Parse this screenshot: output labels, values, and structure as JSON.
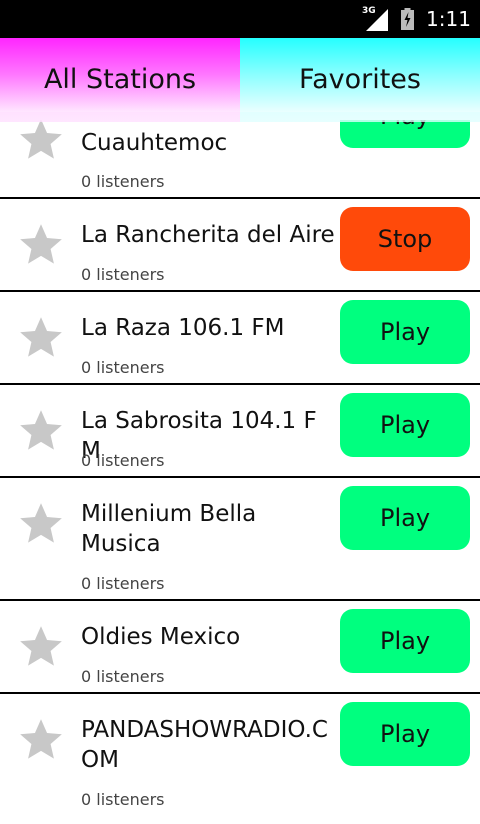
{
  "status_bar": {
    "network": "3G",
    "time": "1:11",
    "icons": [
      "signal-icon",
      "battery-charging-icon"
    ]
  },
  "tabs": [
    {
      "label": "All Stations",
      "color": "#ff26ff"
    },
    {
      "label": "Favorites",
      "color": "#25ffff"
    }
  ],
  "stations": [
    {
      "name": "Cuauhtemoc",
      "listeners": "0 listeners",
      "button": "Play",
      "state": "play"
    },
    {
      "name": "La Rancherita del Aire",
      "listeners": "0 listeners",
      "button": "Stop",
      "state": "stop"
    },
    {
      "name": "La Raza 106.1 FM",
      "listeners": "0 listeners",
      "button": "Play",
      "state": "play"
    },
    {
      "name": "La Sabrosita 104.1 FM",
      "listeners": "0 listeners",
      "button": "Play",
      "state": "play"
    },
    {
      "name": "Millenium Bella Musica",
      "listeners": "0 listeners",
      "button": "Play",
      "state": "play"
    },
    {
      "name": "Oldies Mexico",
      "listeners": "0 listeners",
      "button": "Play",
      "state": "play"
    },
    {
      "name": "PANDASHOWRADIO.COM",
      "listeners": "0 listeners",
      "button": "Play",
      "state": "play"
    }
  ],
  "colors": {
    "play_button": "#00ff7f",
    "stop_button": "#ff4a0a",
    "star": "#c8c8c8"
  }
}
